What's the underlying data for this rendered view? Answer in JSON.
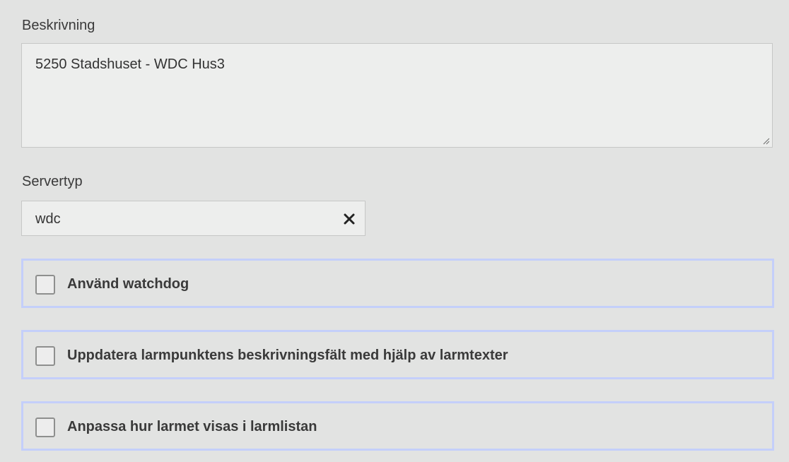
{
  "description": {
    "label": "Beskrivning",
    "value": "5250 Stadshuset - WDC Hus3"
  },
  "server_type": {
    "label": "Servertyp",
    "value": "wdc",
    "clear_icon": "close-icon"
  },
  "options": [
    {
      "label": "Använd watchdog",
      "checked": false
    },
    {
      "label": "Uppdatera larmpunktens beskrivningsfält med hjälp av larmtexter",
      "checked": false
    },
    {
      "label": "Anpassa hur larmet visas i larmlistan",
      "checked": false
    }
  ],
  "colors": {
    "background": "#e2e3e2",
    "field_background": "#edeeed",
    "focus_border": "#c4cffa",
    "text": "#333333"
  }
}
